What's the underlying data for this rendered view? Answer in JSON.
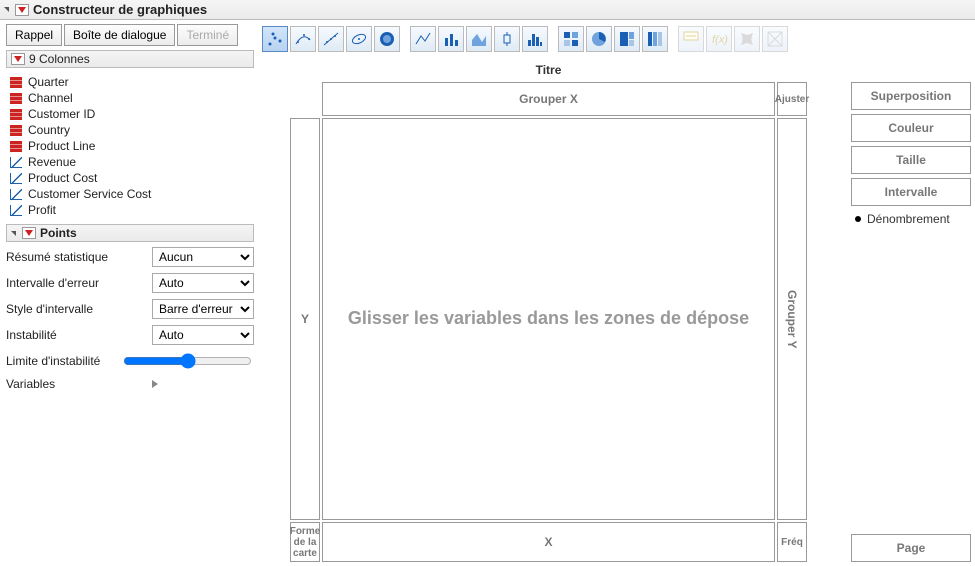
{
  "header": {
    "title": "Constructeur de graphiques"
  },
  "buttons": {
    "recall": "Rappel",
    "dialog": "Boîte de dialogue",
    "done": "Terminé"
  },
  "columns": {
    "count_label": "9 Colonnes",
    "items": [
      {
        "name": "Quarter",
        "type": "nom"
      },
      {
        "name": "Channel",
        "type": "nom"
      },
      {
        "name": "Customer ID",
        "type": "nom"
      },
      {
        "name": "Country",
        "type": "nom"
      },
      {
        "name": "Product Line",
        "type": "nom"
      },
      {
        "name": "Revenue",
        "type": "cont"
      },
      {
        "name": "Product Cost",
        "type": "cont"
      },
      {
        "name": "Customer Service Cost",
        "type": "cont"
      },
      {
        "name": "Profit",
        "type": "cont"
      }
    ]
  },
  "points": {
    "section": "Points",
    "rows": {
      "summary_label": "Résumé statistique",
      "summary_value": "Aucun",
      "error_interval_label": "Intervalle d'erreur",
      "error_interval_value": "Auto",
      "interval_style_label": "Style d'intervalle",
      "interval_style_value": "Barre d'erreur",
      "jitter_label": "Instabilité",
      "jitter_value": "Auto",
      "jitter_limit_label": "Limite d'instabilité",
      "variables_label": "Variables"
    }
  },
  "zones": {
    "title": "Titre",
    "group_x": "Grouper X",
    "fit": "Ajuster",
    "y": "Y",
    "drop": "Glisser les variables dans les zones de dépose",
    "group_y": "Grouper Y",
    "shape": "Forme de la carte",
    "x": "X",
    "freq": "Fréq"
  },
  "right": {
    "overlay": "Superposition",
    "color": "Couleur",
    "size": "Taille",
    "interval": "Intervalle",
    "count": "Dénombrement",
    "page": "Page"
  },
  "toolnames": [
    "points",
    "points-smooth",
    "points-line-fit",
    "ellipse",
    "contour",
    "line",
    "bar",
    "area",
    "boxplot",
    "histogram",
    "heatmap",
    "pie",
    "treemap",
    "mosaic",
    "parallel",
    "formula",
    "map",
    "funnel"
  ]
}
